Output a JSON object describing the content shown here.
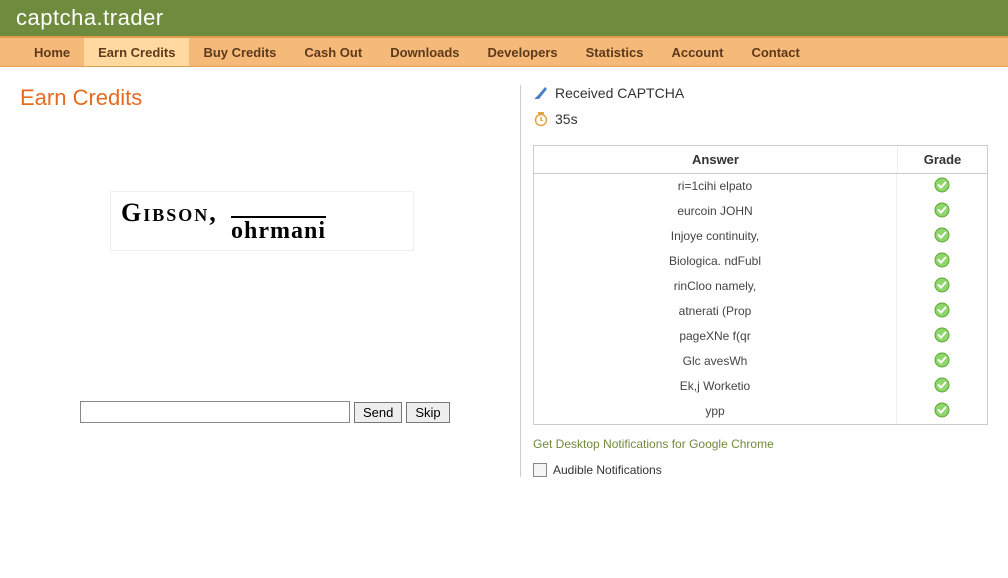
{
  "logo": "captcha.trader",
  "nav": [
    "Home",
    "Earn Credits",
    "Buy Credits",
    "Cash Out",
    "Downloads",
    "Developers",
    "Statistics",
    "Account",
    "Contact"
  ],
  "nav_active_index": 1,
  "page_title": "Earn Credits",
  "captcha": {
    "line1": "Gibson,",
    "line2": "ohrmani"
  },
  "input": {
    "value": "",
    "placeholder": ""
  },
  "buttons": {
    "send": "Send",
    "skip": "Skip"
  },
  "status": {
    "received": "Received CAPTCHA",
    "timer": "35s"
  },
  "table": {
    "headers": {
      "answer": "Answer",
      "grade": "Grade"
    },
    "rows": [
      {
        "answer": "ri=1cihi elpato",
        "grade": "ok"
      },
      {
        "answer": "eurcoin JOHN",
        "grade": "ok"
      },
      {
        "answer": "Injoye continuity,",
        "grade": "ok"
      },
      {
        "answer": "Biologica. ndFubl",
        "grade": "ok"
      },
      {
        "answer": "rinCloo namely,",
        "grade": "ok"
      },
      {
        "answer": "atnerati (Prop",
        "grade": "ok"
      },
      {
        "answer": "pageXNe f(qr",
        "grade": "ok"
      },
      {
        "answer": "Glc avesWh",
        "grade": "ok"
      },
      {
        "answer": "Ek,j Worketio",
        "grade": "ok"
      },
      {
        "answer": "ypp",
        "grade": "ok"
      }
    ]
  },
  "link_chrome": "Get Desktop Notifications for Google Chrome",
  "audible": {
    "label": "Audible Notifications",
    "checked": false
  }
}
